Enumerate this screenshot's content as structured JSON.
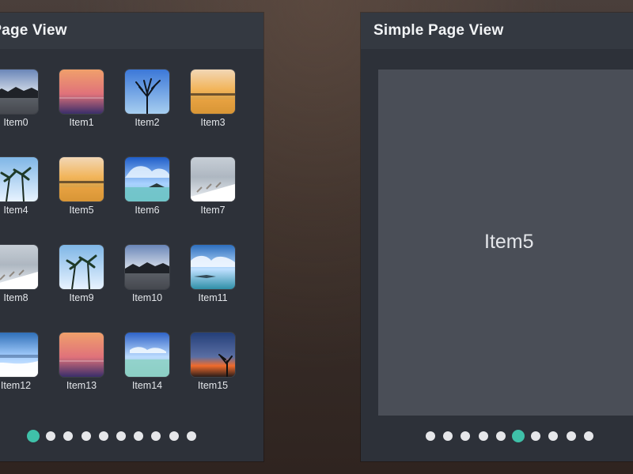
{
  "panels": {
    "grid_view": {
      "title": "Grid Page View",
      "items": [
        {
          "label": "Item0",
          "thumb": "lake-mountains"
        },
        {
          "label": "Item1",
          "thumb": "sunset-pink"
        },
        {
          "label": "Item2",
          "thumb": "bare-tree"
        },
        {
          "label": "Item3",
          "thumb": "sunset-gold"
        },
        {
          "label": "Item4",
          "thumb": "palms-blue"
        },
        {
          "label": "Item5",
          "thumb": "sunset-gold"
        },
        {
          "label": "Item6",
          "thumb": "island-clouds"
        },
        {
          "label": "Item7",
          "thumb": "snow-field"
        },
        {
          "label": "Item8",
          "thumb": "snow-field"
        },
        {
          "label": "Item9",
          "thumb": "palms-blue"
        },
        {
          "label": "Item10",
          "thumb": "lake-mountains"
        },
        {
          "label": "Item11",
          "thumb": "bay-clouds"
        },
        {
          "label": "Item12",
          "thumb": "ice-shore"
        },
        {
          "label": "Item13",
          "thumb": "sunset-pink"
        },
        {
          "label": "Item14",
          "thumb": "beach-clouds"
        },
        {
          "label": "Item15",
          "thumb": "dusk-tree"
        }
      ],
      "pagination": {
        "count": 10,
        "active_index": 0
      }
    },
    "simple_view": {
      "title": "Simple Page View",
      "current_page_label": "Item5",
      "pagination": {
        "count": 10,
        "active_index": 5
      }
    }
  },
  "colors": {
    "accent": "#3fc1a9",
    "panel_bg": "#2d3139",
    "header_bg": "#343941",
    "page_bg": "#4a4e57",
    "dot_inactive": "#e6e7ea"
  }
}
